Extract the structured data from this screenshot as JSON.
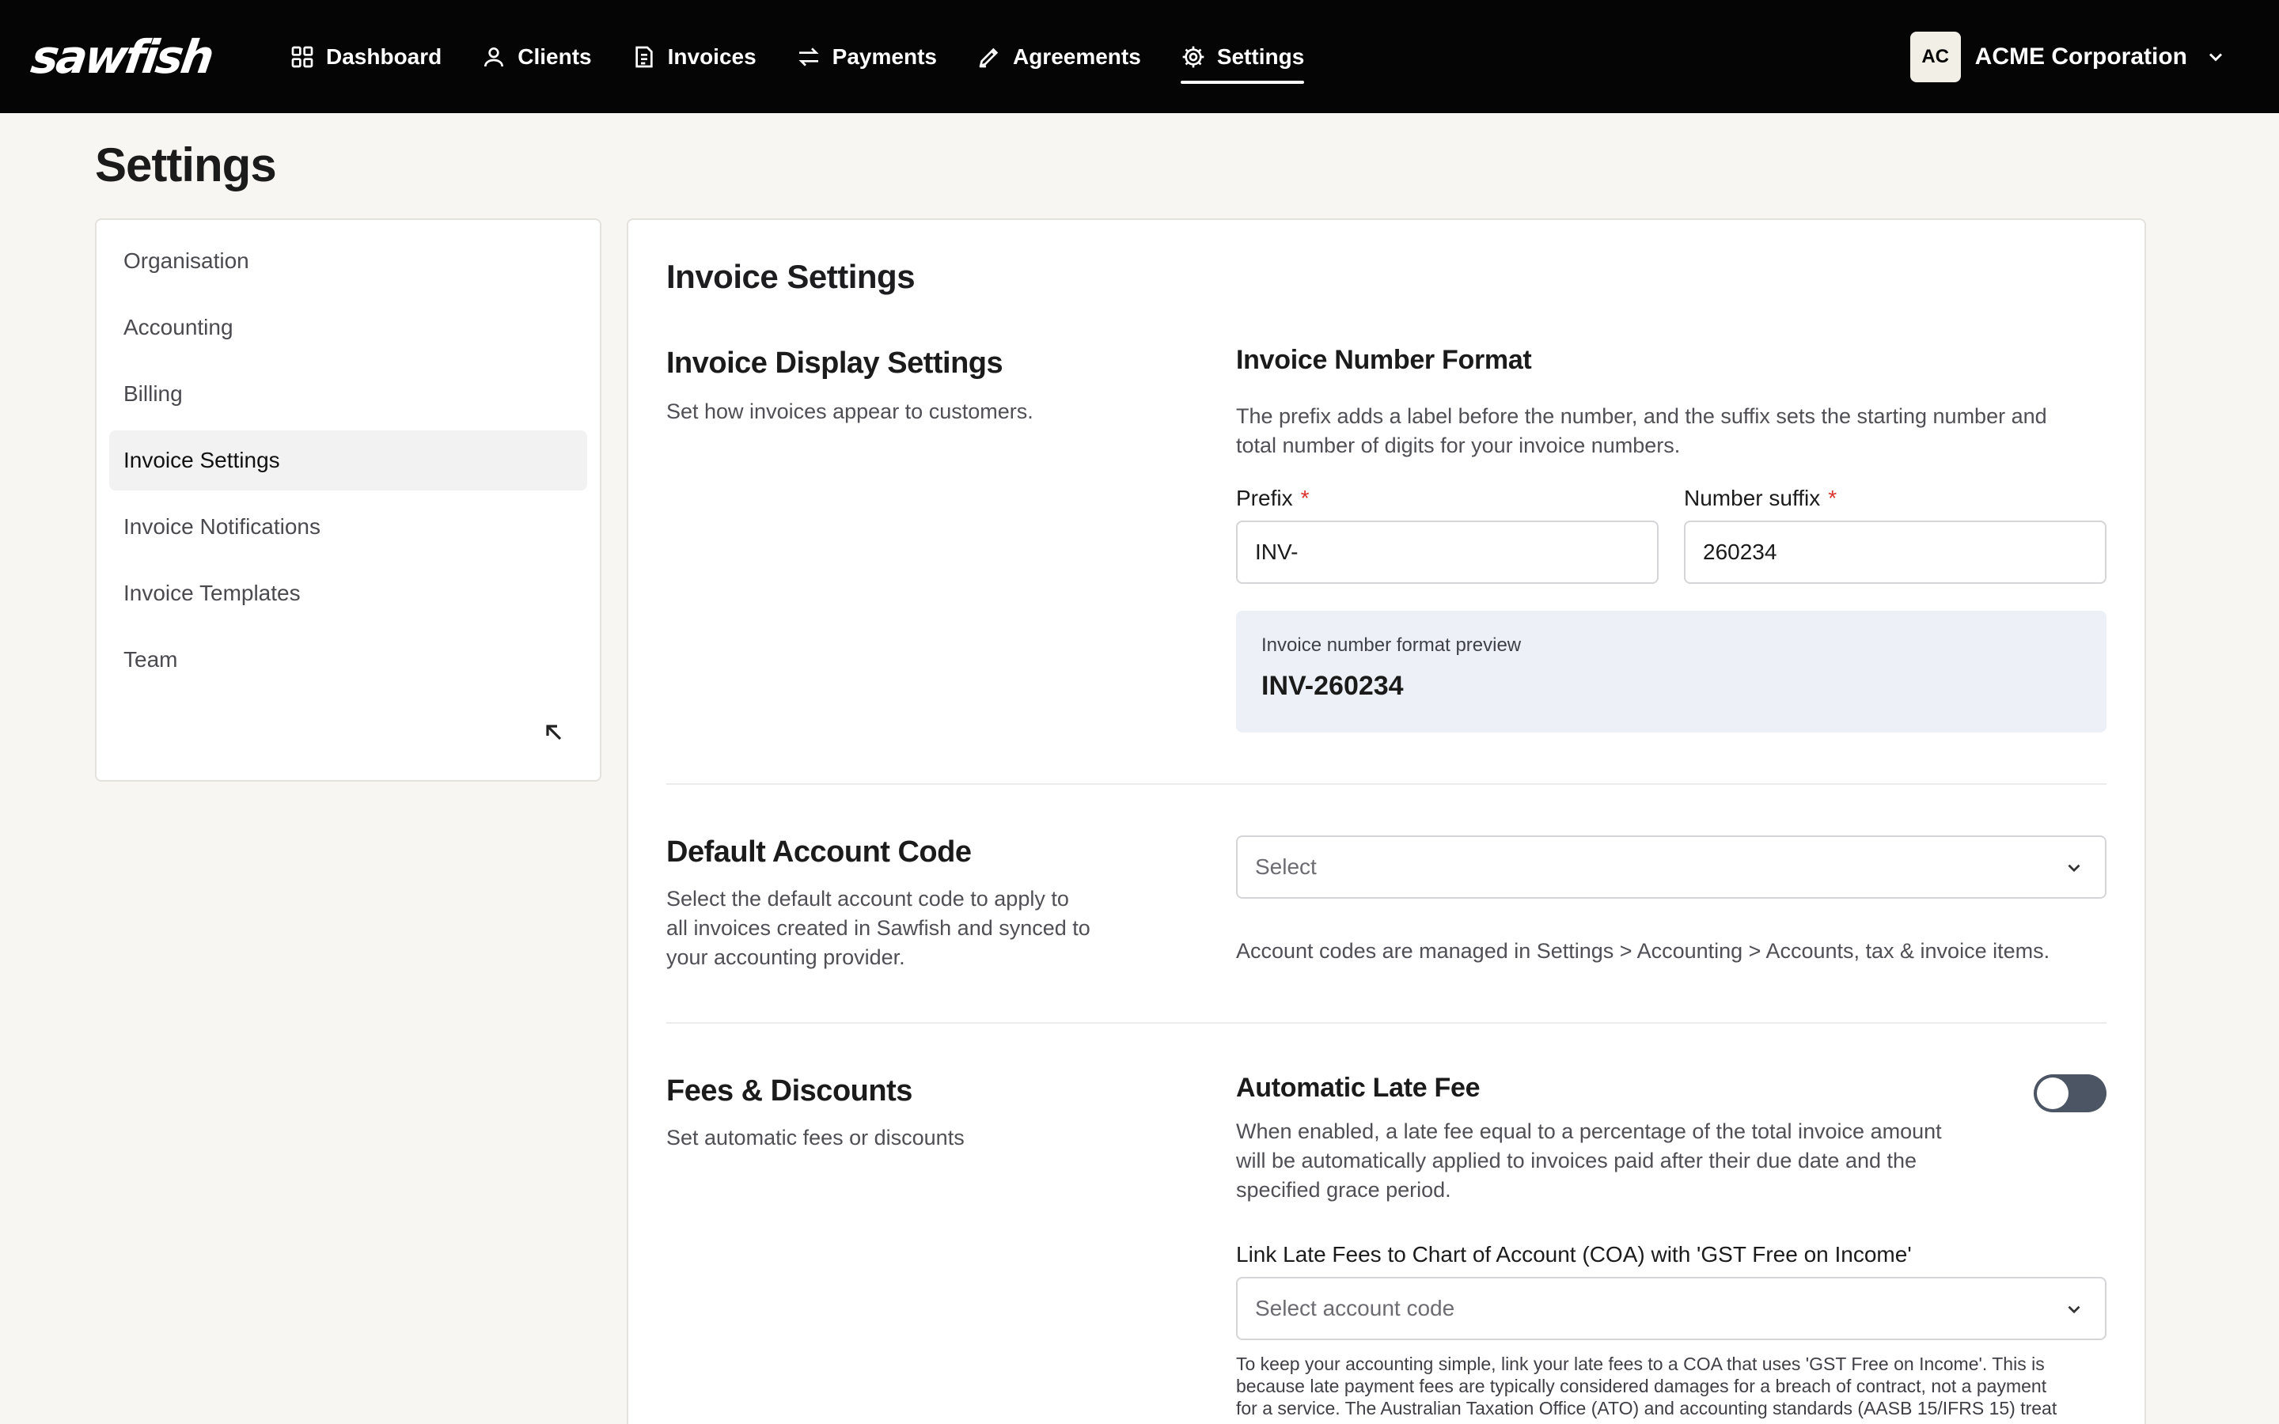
{
  "app": {
    "logo": "sawfish"
  },
  "nav": {
    "items": [
      {
        "label": "Dashboard",
        "icon": "grid-icon"
      },
      {
        "label": "Clients",
        "icon": "user-icon"
      },
      {
        "label": "Invoices",
        "icon": "invoice-icon"
      },
      {
        "label": "Payments",
        "icon": "arrows-icon"
      },
      {
        "label": "Agreements",
        "icon": "pen-icon"
      },
      {
        "label": "Settings",
        "icon": "gear-icon",
        "active": true
      }
    ],
    "org": {
      "initials": "AC",
      "name": "ACME Corporation"
    }
  },
  "page": {
    "title": "Settings"
  },
  "sidebar": {
    "items": [
      {
        "label": "Organisation"
      },
      {
        "label": "Accounting"
      },
      {
        "label": "Billing"
      },
      {
        "label": "Invoice Settings",
        "active": true
      },
      {
        "label": "Invoice Notifications"
      },
      {
        "label": "Invoice Templates"
      },
      {
        "label": "Team"
      }
    ]
  },
  "main": {
    "title": "Invoice Settings",
    "display": {
      "title": "Invoice Display Settings",
      "desc": "Set how invoices appear to customers.",
      "number_format": {
        "title": "Invoice Number Format",
        "desc_line1": "The prefix adds a label before the number, and the suffix sets the starting number and",
        "desc_line2": "total number of digits for your invoice numbers.",
        "prefix_label": "Prefix",
        "prefix_value": "INV-",
        "suffix_label": "Number suffix",
        "suffix_value": "260234",
        "required_mark": "*",
        "preview_label": "Invoice number format preview",
        "preview_value": "INV-260234"
      }
    },
    "account_code": {
      "title": "Default Account Code",
      "desc_line1": "Select the default account code to apply to",
      "desc_line2": "all invoices created in Sawfish and synced to",
      "desc_line3": "your accounting provider.",
      "select_placeholder": "Select",
      "note": "Account codes are managed in Settings > Accounting > Accounts, tax & invoice items."
    },
    "fees": {
      "title": "Fees & Discounts",
      "desc": "Set automatic fees or discounts",
      "late_fee": {
        "title": "Automatic Late Fee",
        "enabled": false,
        "desc_line1": "When enabled, a late fee equal to a percentage of the total invoice amount",
        "desc_line2": "will be automatically applied to invoices paid after their due date and the",
        "desc_line3": "specified grace period."
      },
      "coa": {
        "label": "Link Late Fees to Chart of Account (COA) with 'GST Free on Income'",
        "placeholder": "Select account code",
        "help_line1": "To keep your accounting simple, link your late fees to a COA that uses 'GST Free on Income'. This is",
        "help_line2": "because late payment fees are typically considered damages for a breach of contract, not a payment",
        "help_line3": "for a service. The Australian Taxation Office (ATO) and accounting standards (AASB 15/IFRS 15) treat"
      }
    }
  },
  "colors": {
    "topbar": "#050505",
    "toggle_off": "#4b5563",
    "preview_bg": "#edf1f7",
    "required": "#d9312b"
  }
}
